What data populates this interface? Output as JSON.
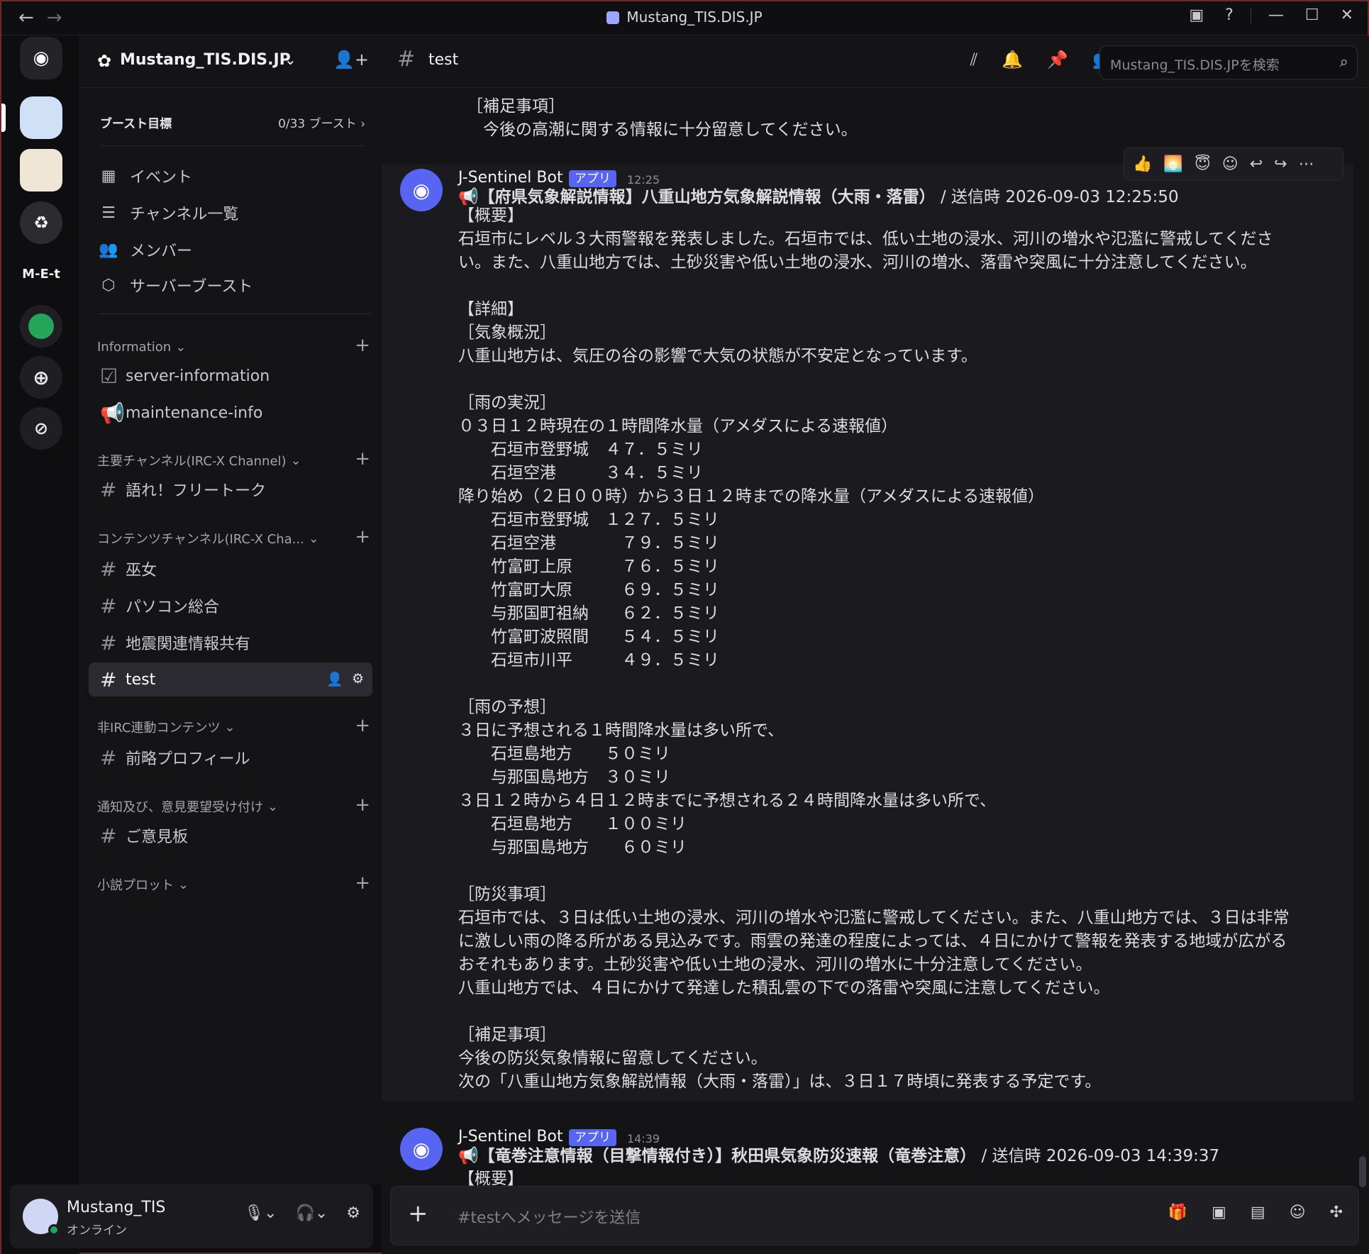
{
  "window": {
    "title": "Mustang_TIS.DIS.JP"
  },
  "server": {
    "name": "Mustang_TIS.DIS.JP"
  },
  "boost": {
    "label": "ブースト目標",
    "count": "0/33 ブースト"
  },
  "menu": [
    {
      "label": "イベント",
      "icon": "calendar-icon"
    },
    {
      "label": "チャンネル一覧",
      "icon": "channel-list-icon"
    },
    {
      "label": "メンバー",
      "icon": "members-icon"
    },
    {
      "label": "サーバーブースト",
      "icon": "boost-icon"
    }
  ],
  "categories": [
    {
      "name": "Information",
      "channels": [
        {
          "name": "server-information",
          "icon": "checklist-icon"
        },
        {
          "name": "maintenance-info",
          "icon": "megaphone-icon"
        }
      ]
    },
    {
      "name": "主要チャンネル(IRC-X Channel)",
      "channels": [
        {
          "name": "語れ！フリートーク"
        }
      ]
    },
    {
      "name": "コンテンツチャンネル(IRC-X Cha...",
      "channels": [
        {
          "name": "巫女"
        },
        {
          "name": "パソコン総合"
        },
        {
          "name": "地震関連情報共有"
        },
        {
          "name": "test",
          "active": true
        }
      ]
    },
    {
      "name": "非IRC連動コンテンツ",
      "channels": [
        {
          "name": "前略プロフィール"
        }
      ]
    },
    {
      "name": "通知及び、意見要望受け付け",
      "channels": [
        {
          "name": "ご意見板"
        }
      ]
    },
    {
      "name": "小説プロット",
      "channels": []
    }
  ],
  "user": {
    "name": "Mustang_TIS",
    "status": "オンライン"
  },
  "channel": {
    "name": "test"
  },
  "search": {
    "placeholder": "Mustang_TIS.DIS.JPを検索"
  },
  "rail": {
    "text_server": "M-E-t"
  },
  "prev_tail": [
    "［補足事項］",
    "　今後の高潮に関する情報に十分留意してください。"
  ],
  "message1": {
    "author": "J-Sentinel Bot",
    "badge": "アプリ",
    "time": "12:25",
    "title": "【府県気象解説情報】八重山地方気象解説情報（大雨・落雷）",
    "sent": "/ 送信時 2026-09-03 12:25:50",
    "lines": [
      "【概要】",
      "石垣市にレベル３大雨警報を発表しました。石垣市では、低い土地の浸水、河川の増水や氾濫に警戒してくださ",
      "い。また、八重山地方では、土砂災害や低い土地の浸水、河川の増水、落雷や突風に十分注意してください。",
      "",
      "【詳細】",
      "［気象概況］",
      "八重山地方は、気圧の谷の影響で大気の状態が不安定となっています。",
      "",
      "［雨の実況］",
      "０３日１２時現在の１時間降水量（アメダスによる速報値）",
      "　　石垣市登野城　４７．５ミリ",
      "　　石垣空港　　　３４．５ミリ",
      "降り始め（２日００時）から３日１２時までの降水量（アメダスによる速報値）",
      "　　石垣市登野城　１２７．５ミリ",
      "　　石垣空港　　　　７９．５ミリ",
      "　　竹富町上原　　　７６．５ミリ",
      "　　竹富町大原　　　６９．５ミリ",
      "　　与那国町祖納　　６２．５ミリ",
      "　　竹富町波照間　　５４．５ミリ",
      "　　石垣市川平　　　４９．５ミリ",
      "",
      "［雨の予想］",
      "３日に予想される１時間降水量は多い所で、",
      "　　石垣島地方　　５０ミリ",
      "　　与那国島地方　３０ミリ",
      "３日１２時から４日１２時までに予想される２４時間降水量は多い所で、",
      "　　石垣島地方　　１００ミリ",
      "　　与那国島地方　　６０ミリ",
      "",
      "［防災事項］",
      "石垣市では、３日は低い土地の浸水、河川の増水や氾濫に警戒してください。また、八重山地方では、３日は非常",
      "に激しい雨の降る所がある見込みです。雨雲の発達の程度によっては、４日にかけて警報を発表する地域が広がる",
      "おそれもあります。土砂災害や低い土地の浸水、河川の増水に十分注意してください。",
      "八重山地方では、４日にかけて発達した積乱雲の下での落雷や突風に注意してください。",
      "",
      "［補足事項］",
      "今後の防災気象情報に留意してください。",
      "次の「八重山地方気象解説情報（大雨・落雷）」は、３日１７時頃に発表する予定です。"
    ]
  },
  "message2": {
    "author": "J-Sentinel Bot",
    "badge": "アプリ",
    "time": "14:39",
    "title": "【竜巻注意情報（目撃情報付き）】秋田県気象防災速報（竜巻注意）",
    "sent": "/ 送信時 2026-09-03 14:39:37",
    "first": "【概要】"
  },
  "composer": {
    "placeholder": "#testへメッセージを送信"
  },
  "reactions": [
    "👍",
    "🌅",
    "😇"
  ]
}
